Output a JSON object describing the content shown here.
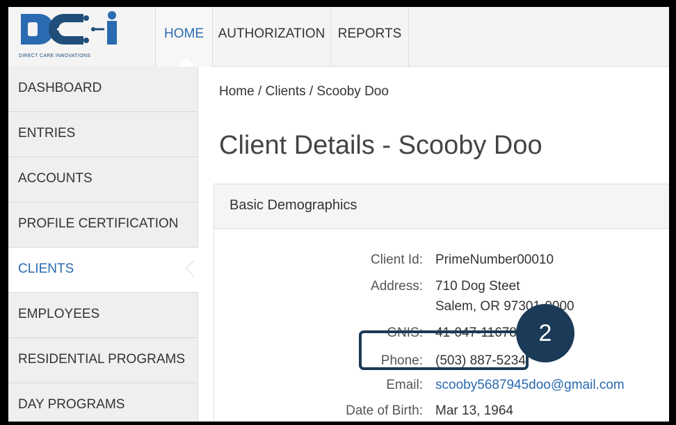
{
  "logo": {
    "caption": "DIRECT CARE INNOVATIONS"
  },
  "topnav": {
    "items": [
      {
        "label": "HOME"
      },
      {
        "label": "AUTHORIZATION"
      },
      {
        "label": "REPORTS"
      }
    ]
  },
  "sidebar": {
    "items": [
      {
        "label": "DASHBOARD"
      },
      {
        "label": "ENTRIES"
      },
      {
        "label": "ACCOUNTS"
      },
      {
        "label": "PROFILE CERTIFICATION"
      },
      {
        "label": "CLIENTS"
      },
      {
        "label": "EMPLOYEES"
      },
      {
        "label": "RESIDENTIAL PROGRAMS"
      },
      {
        "label": "DAY PROGRAMS"
      }
    ],
    "active": "CLIENTS"
  },
  "breadcrumb": "Home / Clients / Scooby Doo",
  "page_title": "Client Details - Scooby Doo",
  "panel": {
    "title": "Basic Demographics",
    "fields": {
      "client_id": {
        "label": "Client Id:",
        "value": "PrimeNumber00010"
      },
      "address": {
        "label": "Address:",
        "line1": "710 Dog Steet",
        "line2": "Salem,  OR 97301-0000"
      },
      "gnis": {
        "label": "GNIS:",
        "value": "41-047-11678"
      },
      "phone": {
        "label": "Phone:",
        "value": "(503) 887-5234"
      },
      "email": {
        "label": "Email:",
        "value": "scooby5687945doo@gmail.com"
      },
      "dob": {
        "label": "Date of Birth:",
        "value": "Mar 13, 1964"
      }
    }
  },
  "callout": {
    "step": "2"
  },
  "colors": {
    "accent": "#2a6ab0",
    "callout": "#1b3a57"
  }
}
